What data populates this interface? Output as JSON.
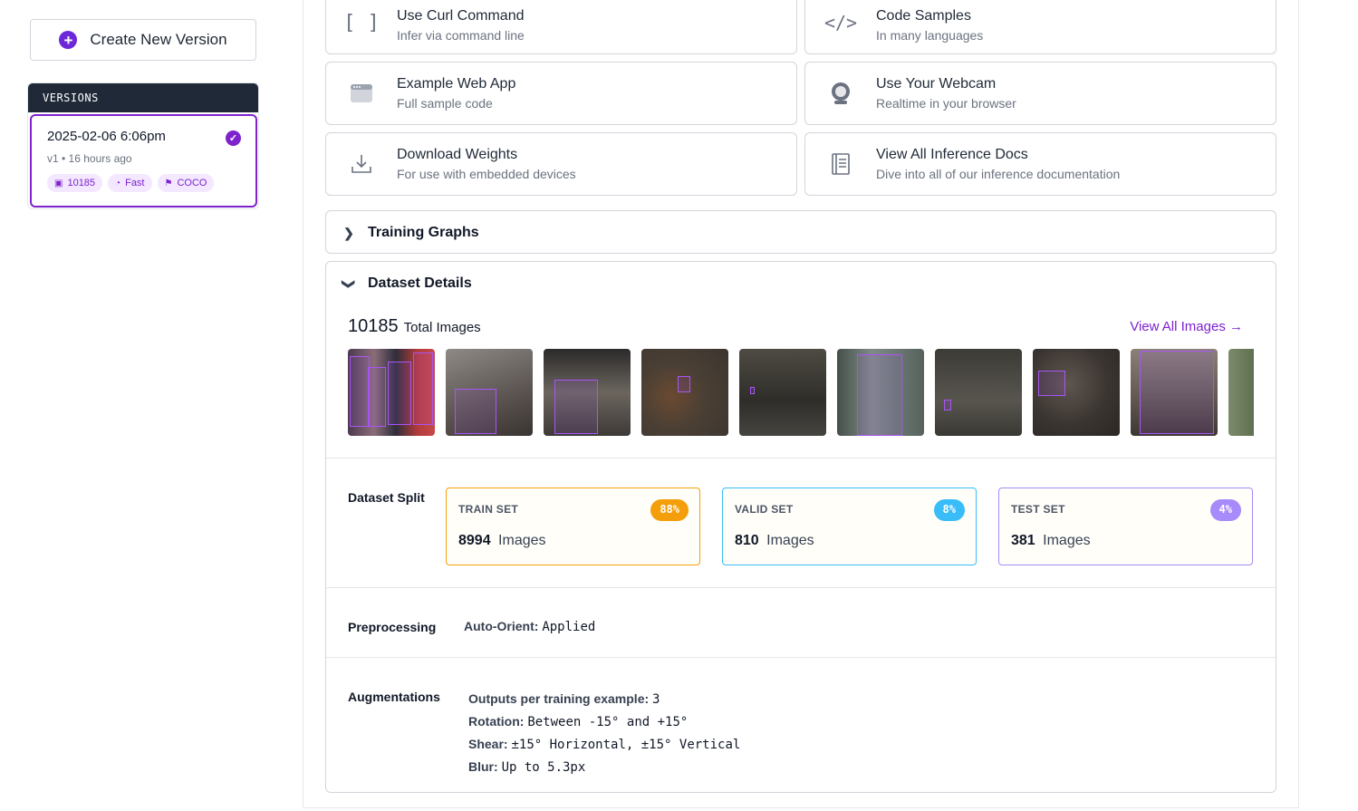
{
  "sidebar": {
    "create_button": "Create New Version",
    "versions_heading": "VERSIONS",
    "version": {
      "date": "2025-02-06 6:06pm",
      "meta": "v1 • 16 hours ago",
      "chips": [
        {
          "icon": "image-icon",
          "label": "10185"
        },
        {
          "icon": "speed-icon",
          "label": "Fast"
        },
        {
          "icon": "flag-icon",
          "label": "COCO"
        }
      ]
    }
  },
  "deploy_cards": [
    {
      "title": "Use Curl Command",
      "subtitle": "Infer via command line",
      "icon": "brackets-icon"
    },
    {
      "title": "Code Samples",
      "subtitle": "In many languages",
      "icon": "code-icon"
    },
    {
      "title": "Example Web App",
      "subtitle": "Full sample code",
      "icon": "browser-icon"
    },
    {
      "title": "Use Your Webcam",
      "subtitle": "Realtime in your browser",
      "icon": "webcam-icon"
    },
    {
      "title": "Download Weights",
      "subtitle": "For use with embedded devices",
      "icon": "download-icon"
    },
    {
      "title": "View All Inference Docs",
      "subtitle": "Dive into all of our inference documentation",
      "icon": "book-icon"
    }
  ],
  "training_graphs": {
    "title": "Training Graphs"
  },
  "dataset": {
    "title": "Dataset Details",
    "total_count": "10185",
    "total_label": "Total Images",
    "view_all": "View All Images →",
    "split_label": "Dataset Split",
    "splits": [
      {
        "name": "TRAIN SET",
        "pct": "88%",
        "count": "8994",
        "unit": "Images",
        "color": "#f59e0b"
      },
      {
        "name": "VALID SET",
        "pct": "8%",
        "count": "810",
        "unit": "Images",
        "color": "#38bdf8"
      },
      {
        "name": "TEST SET",
        "pct": "4%",
        "count": "381",
        "unit": "Images",
        "color": "#a78bfa"
      }
    ],
    "preprocessing_label": "Preprocessing",
    "preprocessing": {
      "key": "Auto-Orient:",
      "value": "Applied"
    },
    "augmentations_label": "Augmentations",
    "augmentations": [
      {
        "key": "Outputs per training example:",
        "value": "3"
      },
      {
        "key": "Rotation:",
        "value": "Between -15° and +15°"
      },
      {
        "key": "Shear:",
        "value": "±15° Horizontal, ±15° Vertical"
      },
      {
        "key": "Blur:",
        "value": "Up to 5.3px"
      }
    ]
  }
}
